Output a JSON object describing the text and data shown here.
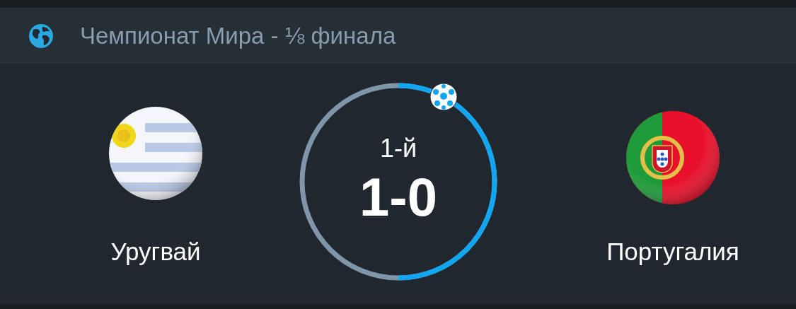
{
  "header": {
    "title": "Чемпионат Мира - ⅛ финала"
  },
  "match": {
    "period": "1-й",
    "score": "1-0",
    "progress": {
      "level": 0.5
    },
    "teams": [
      {
        "name": "Уругвай"
      },
      {
        "name": "Португалия"
      }
    ]
  }
}
